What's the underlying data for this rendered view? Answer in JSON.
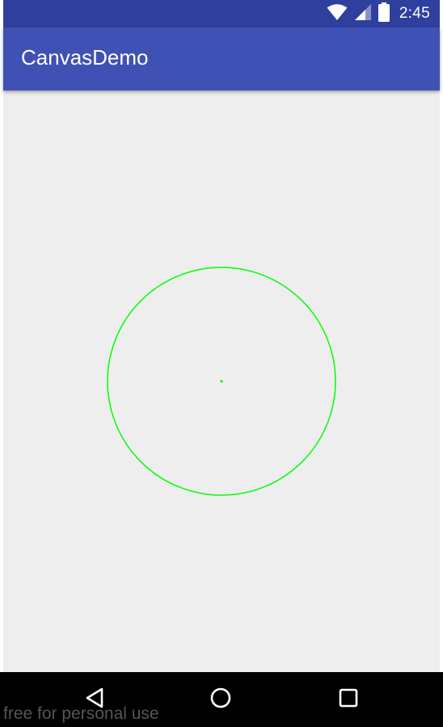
{
  "status_bar": {
    "time": "2:45",
    "icons": [
      "wifi-icon",
      "cell-signal-icon",
      "battery-icon"
    ],
    "background": "#2f3f9e"
  },
  "app_bar": {
    "title": "CanvasDemo",
    "background": "#3f51b5"
  },
  "canvas": {
    "background": "#eeeeee",
    "stroke_color": "#00ff00",
    "shapes": [
      "circle-outline",
      "center-dot"
    ]
  },
  "nav_bar": {
    "buttons": [
      "back-icon",
      "home-icon",
      "recents-icon"
    ],
    "background": "#000000"
  },
  "watermark": {
    "text": "free for personal use"
  }
}
